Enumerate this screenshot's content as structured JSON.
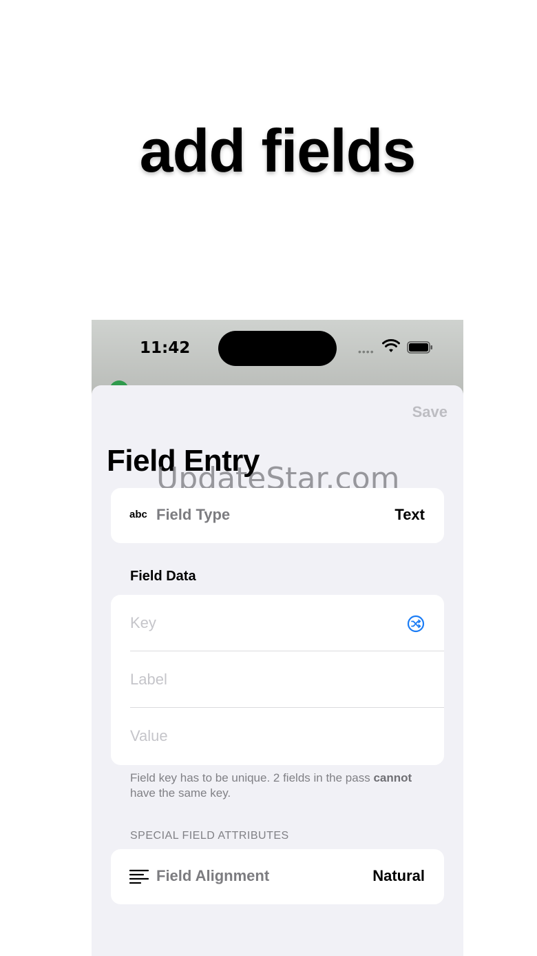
{
  "headline": "add fields",
  "status_bar": {
    "time": "11:42",
    "signal": "••••"
  },
  "nav": {
    "save_label": "Save"
  },
  "page": {
    "title": "Field Entry",
    "watermark": "UpdateStar.com"
  },
  "field_type_row": {
    "icon_text": "abc",
    "label": "Field Type",
    "value": "Text"
  },
  "field_data": {
    "header": "Field Data",
    "key_placeholder": "Key",
    "label_placeholder": "Label",
    "value_placeholder": "Value",
    "footnote_part1": "Field key has to be unique. 2 fields in the pass ",
    "footnote_bold": "cannot",
    "footnote_part2": " have the same key."
  },
  "special": {
    "header": "SPECIAL FIELD ATTRIBUTES",
    "alignment_label": "Field Alignment",
    "alignment_value": "Natural"
  },
  "colors": {
    "accent": "#1a7cf5",
    "sheet_bg": "#f1f1f6",
    "placeholder": "#c5c5ca"
  }
}
